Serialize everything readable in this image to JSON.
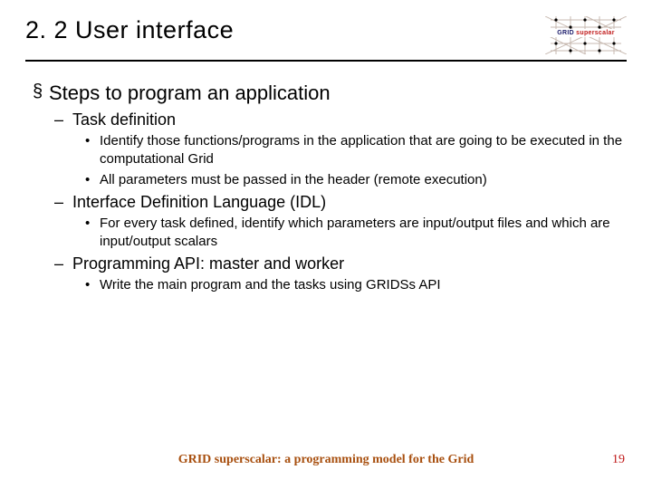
{
  "header": {
    "title": "2. 2 User interface",
    "logo": {
      "brand1": "GRID",
      "brand2": "superscalar"
    }
  },
  "content": {
    "l1": "Steps to program an application",
    "a": {
      "title": "Task definition",
      "b1": "Identify those functions/programs in the application that are going to be executed in the computational Grid",
      "b2": "All parameters must be passed in the header (remote execution)"
    },
    "b": {
      "title": "Interface Definition Language (IDL)",
      "b1": "For every task defined, identify which parameters are input/output files and which are input/output scalars"
    },
    "c": {
      "title": "Programming API: master and worker",
      "b1": "Write the main program and the tasks using GRIDSs API"
    }
  },
  "footer": {
    "text": "GRID superscalar: a programming model for the Grid",
    "page": "19"
  }
}
